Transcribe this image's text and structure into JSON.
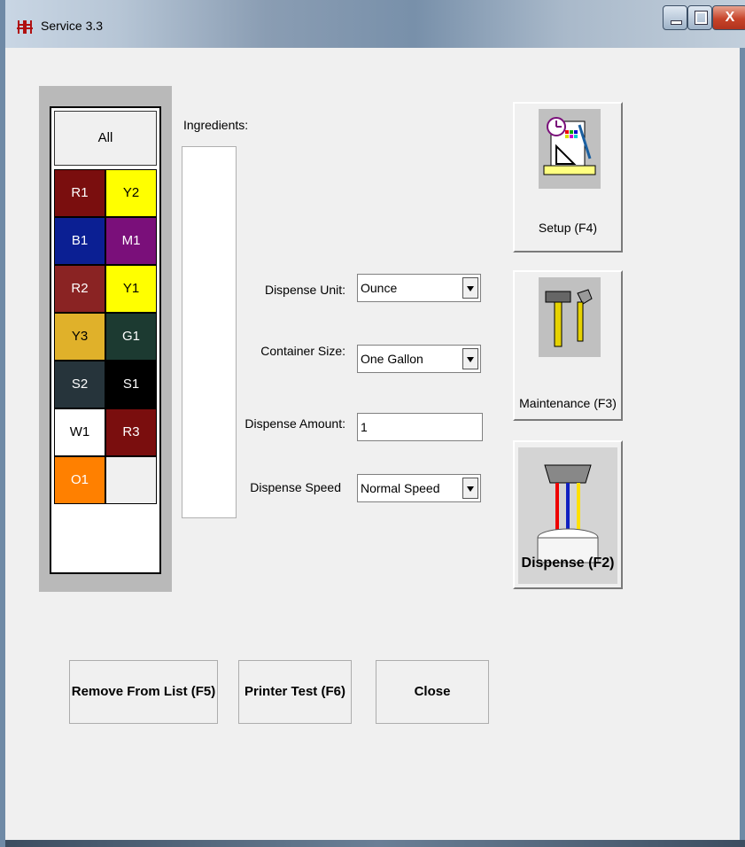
{
  "window": {
    "title": "Service 3.3",
    "close_label": "X",
    "title_icon": "app-logo-icon"
  },
  "palette": {
    "all_label": "All",
    "cells": [
      {
        "label": "R1",
        "bg": "#7a0e0e",
        "fg": "#ffffff"
      },
      {
        "label": "Y2",
        "bg": "#ffff00",
        "fg": "#000000"
      },
      {
        "label": "B1",
        "bg": "#0b1f93",
        "fg": "#ffffff"
      },
      {
        "label": "M1",
        "bg": "#7a0f7a",
        "fg": "#ffffff"
      },
      {
        "label": "R2",
        "bg": "#8a2323",
        "fg": "#ffffff"
      },
      {
        "label": "Y1",
        "bg": "#ffff00",
        "fg": "#000000"
      },
      {
        "label": "Y3",
        "bg": "#e0b12a",
        "fg": "#000000"
      },
      {
        "label": "G1",
        "bg": "#1c3a31",
        "fg": "#ffffff"
      },
      {
        "label": "S2",
        "bg": "#26343b",
        "fg": "#ffffff"
      },
      {
        "label": "S1",
        "bg": "#000000",
        "fg": "#ffffff"
      },
      {
        "label": "W1",
        "bg": "#ffffff",
        "fg": "#000000"
      },
      {
        "label": "R3",
        "bg": "#7a0e0e",
        "fg": "#ffffff"
      },
      {
        "label": "O1",
        "bg": "#ff8000",
        "fg": "#ffffff"
      },
      {
        "label": "",
        "bg": "#f0f0f0",
        "fg": "#000000"
      }
    ]
  },
  "ingredients": {
    "label": "Ingredients:"
  },
  "form": {
    "dispense_unit": {
      "label": "Dispense Unit:",
      "value": "Ounce"
    },
    "container_size": {
      "label": "Container Size:",
      "value": "One Gallon"
    },
    "dispense_amount": {
      "label": "Dispense Amount:",
      "value": "1"
    },
    "dispense_speed": {
      "label": "Dispense Speed",
      "value": "Normal Speed"
    }
  },
  "side_buttons": {
    "setup": "Setup (F4)",
    "maintenance": "Maintenance (F3)",
    "dispense": "Dispense (F2)"
  },
  "actions": {
    "remove": "Remove From List (F5)",
    "printer_test": "Printer Test (F6)",
    "close": "Close"
  }
}
